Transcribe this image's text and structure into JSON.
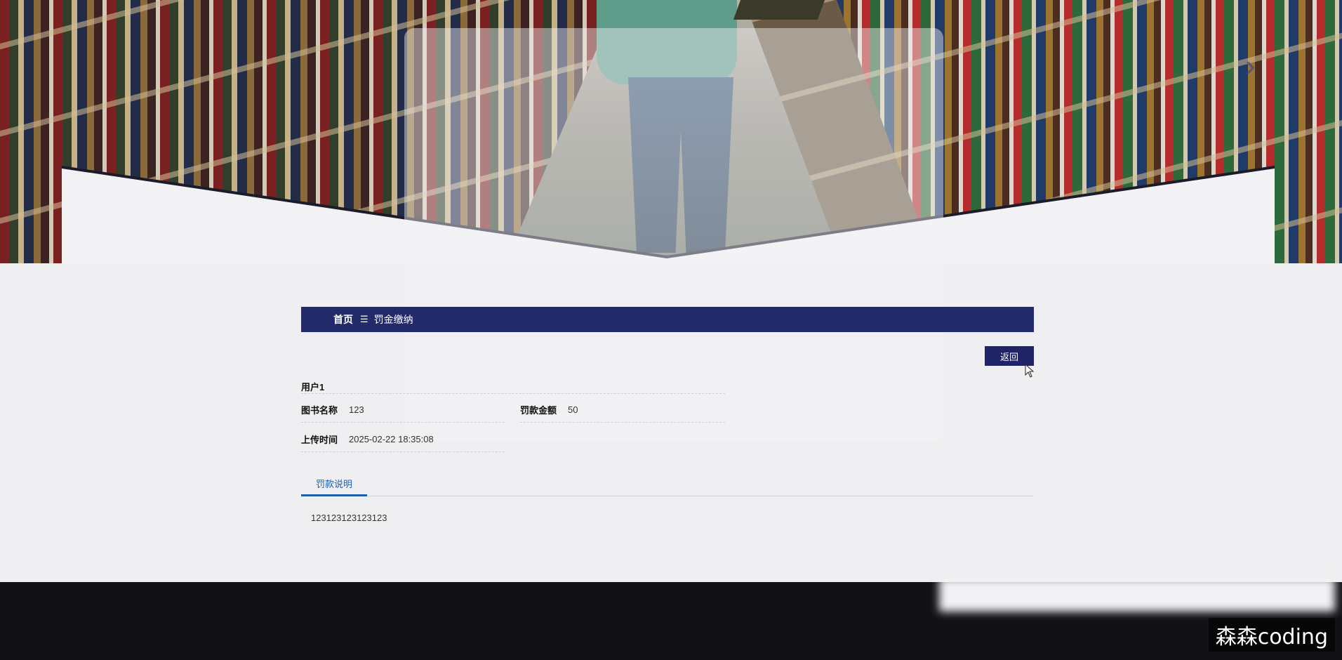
{
  "breadcrumb": {
    "home": "首页",
    "separator": "☰",
    "current": "罚金缴纳"
  },
  "actions": {
    "back_label": "返回"
  },
  "detail": {
    "user": "用户1",
    "book_name_label": "图书名称",
    "book_name_value": "123",
    "fine_amount_label": "罚款金额",
    "fine_amount_value": "50",
    "upload_time_label": "上传时间",
    "upload_time_value": "2025-02-22 18:35:08"
  },
  "tabs": [
    {
      "label": "罚款说明",
      "active": true
    }
  ],
  "tab_content": "123123123123123",
  "watermark": "森森coding",
  "colors": {
    "primary": "#232a6a",
    "button": "#1f2466",
    "tab_accent": "#1f5fa8",
    "footer": "#121216",
    "page_bg": "#efeef0"
  },
  "icons": {
    "banner_next": "chevron-right-icon",
    "cursor": "mouse-pointer-icon"
  }
}
